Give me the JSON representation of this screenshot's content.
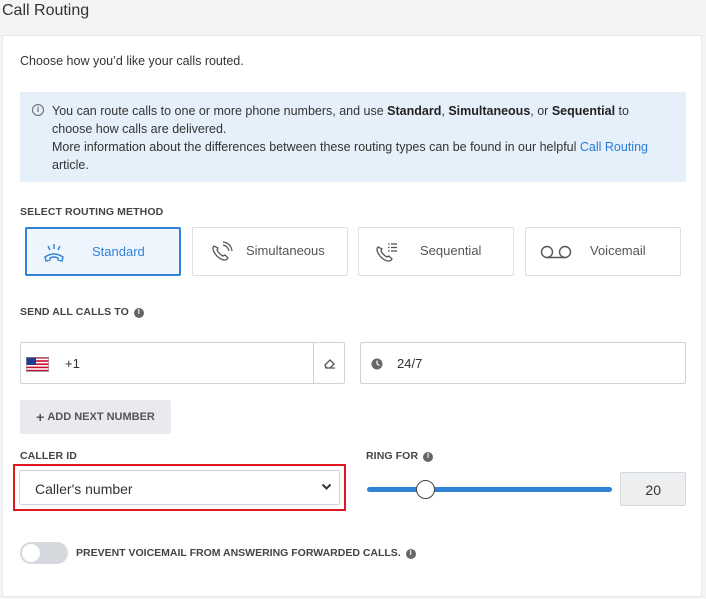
{
  "page": {
    "title": "Call Routing"
  },
  "intro": "Choose how you’d like your calls routed.",
  "info": {
    "text1": "You can route calls to one or more phone numbers, and use ",
    "bold1": "Standard",
    "sep1": ", ",
    "bold2": "Simultaneous",
    "sep2": ", or ",
    "bold3": "Sequential",
    "text2": " to choose how calls are delivered.",
    "text3": "More information about the differences between these routing types can be found in our helpful ",
    "link": "Call Routing",
    "text4": " article."
  },
  "routing": {
    "section_label": "SELECT ROUTING METHOD",
    "selected": "Standard",
    "methods": [
      {
        "label": "Standard",
        "icon": "phone-ringing-icon"
      },
      {
        "label": "Simultaneous",
        "icon": "phone-forward-icon"
      },
      {
        "label": "Sequential",
        "icon": "phone-list-icon"
      },
      {
        "label": "Voicemail",
        "icon": "voicemail-icon"
      }
    ]
  },
  "send": {
    "section_label": "SEND ALL CALLS TO",
    "country_flag": "us-flag-icon",
    "dial_code": "+1",
    "phone_value": "",
    "schedule": "24/7",
    "add_button": "ADD NEXT NUMBER"
  },
  "caller_id": {
    "label": "CALLER ID",
    "selected": "Caller's number"
  },
  "ring_for": {
    "label": "RING FOR",
    "value": "20",
    "slider_fraction": 0.24
  },
  "voicemail_toggle": {
    "label": "PREVENT VOICEMAIL FROM ANSWERING FORWARDED CALLS.",
    "on": false
  },
  "colors": {
    "accent": "#2f82d6",
    "highlight": "#e0181f",
    "info_bg": "#e6f0fa"
  }
}
